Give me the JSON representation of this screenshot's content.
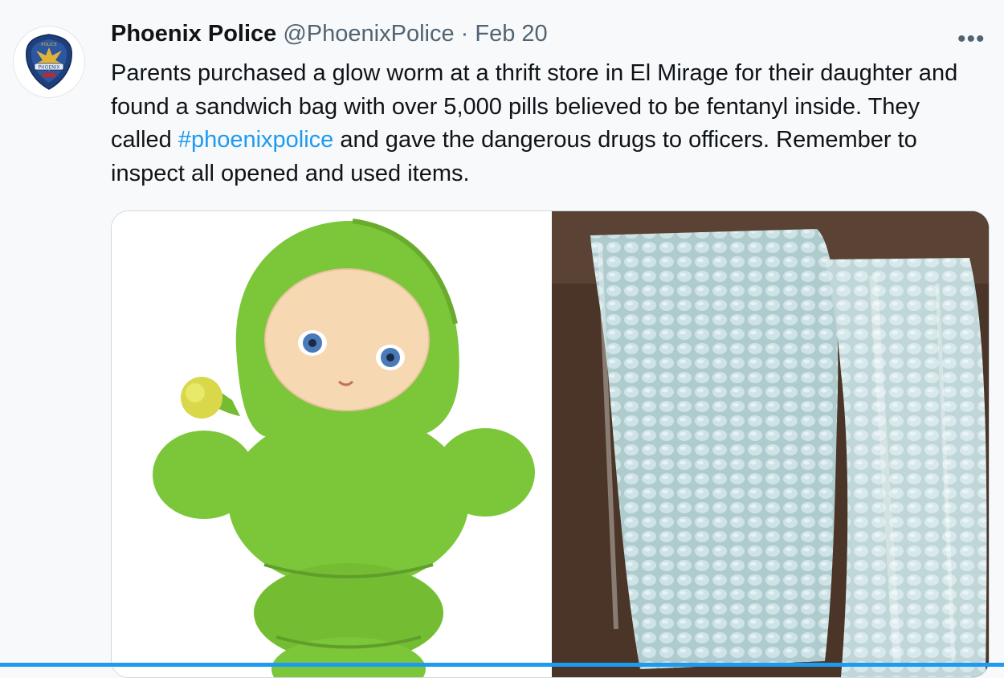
{
  "tweet": {
    "author_name": "Phoenix Police",
    "author_handle": "@PhoenixPolice",
    "separator": "·",
    "date": "Feb 20",
    "more_label": "•••",
    "text_before": "Parents purchased a glow worm at a thrift store in El Mirage for their daughter and found a sandwich bag with over 5,000 pills believed to be fentanyl inside. They called ",
    "hashtag": "#phoenixpolice",
    "text_after": " and gave the dangerous drugs to officers. Remember to inspect all opened and used items.",
    "avatar_badge_text": "POLICE",
    "avatar_badge_city": "PHOENIX"
  },
  "icons": {
    "more": "more-options-icon",
    "avatar": "police-badge-logo"
  },
  "colors": {
    "link": "#1d9bf0",
    "secondary_text": "#536471",
    "toy_green": "#7cc63a",
    "badge_navy": "#1f3f7a",
    "badge_gold": "#e0b43a"
  }
}
